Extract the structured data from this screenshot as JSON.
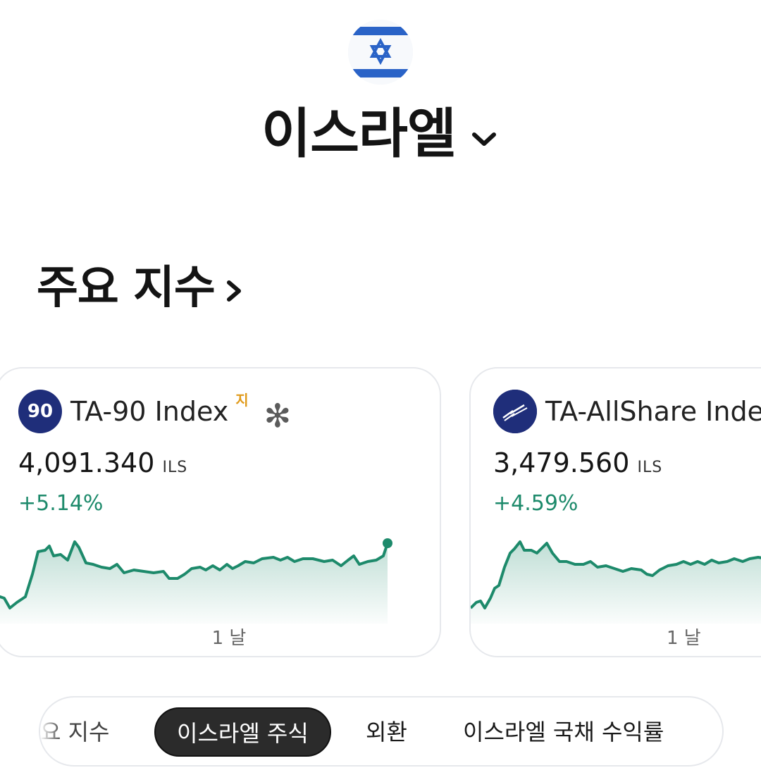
{
  "header": {
    "flag_icon": "israel-flag-icon",
    "country": "이스라엘"
  },
  "section": {
    "title": "주요 지수"
  },
  "cards": [
    {
      "logo_text": "90",
      "name": "TA-90 Index",
      "badge": "지",
      "price": "4,091.340",
      "currency": "ILS",
      "change": "+5.14%",
      "period": "1 날",
      "trend_color": "#1d8a6b"
    },
    {
      "logo_text": "",
      "name": "TA-AllShare Inde",
      "price": "3,479.560",
      "currency": "ILS",
      "change": "+4.59%",
      "period": "1 날",
      "trend_color": "#1d8a6b"
    }
  ],
  "tabs": [
    {
      "label": "요 지수",
      "active": false
    },
    {
      "label": "이스라엘 주식",
      "active": true
    },
    {
      "label": "외환",
      "active": false
    },
    {
      "label": "이스라엘 국채 수익률",
      "active": false
    }
  ],
  "colors": {
    "positive": "#1d8a6b",
    "logo_bg": "#1f2e7a",
    "badge": "#e09a1a",
    "active_tab_bg": "#2b2b2b"
  }
}
